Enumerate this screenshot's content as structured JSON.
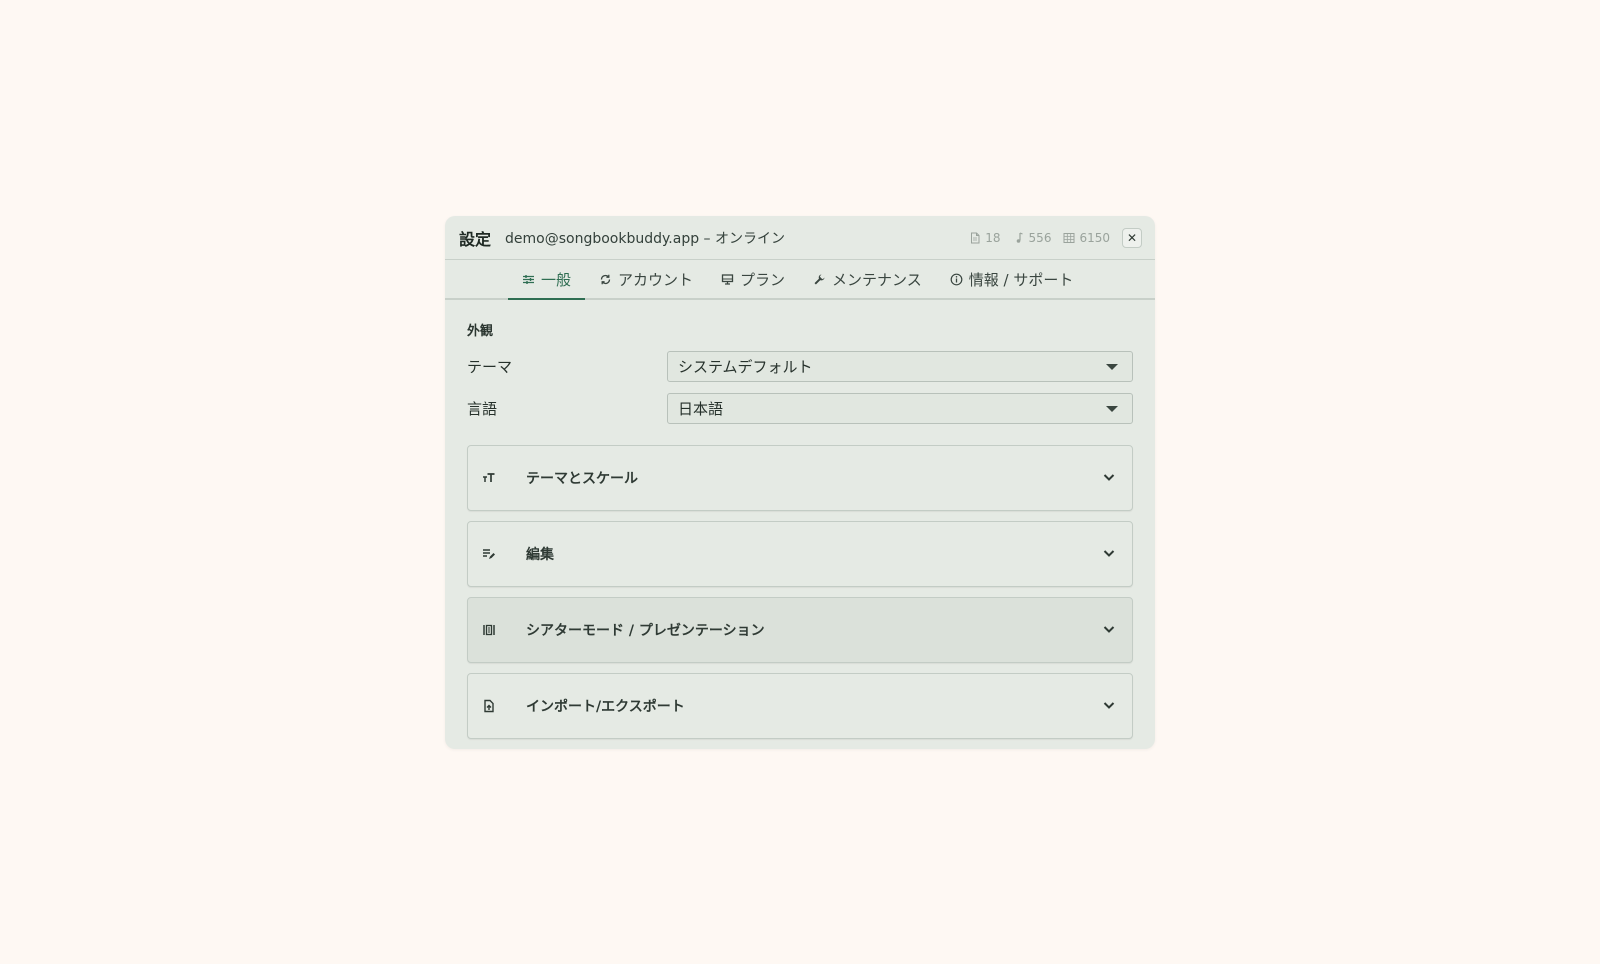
{
  "dialog": {
    "title": "設定",
    "account_status": "demo@songbookbuddy.app – オンライン",
    "stats": [
      {
        "icon": "document-icon",
        "value": "18"
      },
      {
        "icon": "music-note-icon",
        "value": "556"
      },
      {
        "icon": "grid-icon",
        "value": "6150"
      }
    ],
    "close_label": "✕"
  },
  "tabs": [
    {
      "icon": "sliders-icon",
      "label": "一般",
      "active": true
    },
    {
      "icon": "sync-icon",
      "label": "アカウント"
    },
    {
      "icon": "monitor-icon",
      "label": "プラン"
    },
    {
      "icon": "wrench-icon",
      "label": "メンテナンス"
    },
    {
      "icon": "info-icon",
      "label": "情報 / サポート"
    }
  ],
  "appearance": {
    "section_label": "外観",
    "theme_label": "テーマ",
    "theme_value": "システムデフォルト",
    "language_label": "言語",
    "language_value": "日本語"
  },
  "accordion": [
    {
      "icon": "text-size-icon",
      "label": "テーマとスケール"
    },
    {
      "icon": "edit-list-icon",
      "label": "編集"
    },
    {
      "icon": "theater-icon",
      "label": "シアターモード / プレゼンテーション"
    },
    {
      "icon": "file-import-icon",
      "label": "インポート/エクスポート"
    }
  ],
  "colors": {
    "accent": "#2f6e52",
    "background": "#fef8f3",
    "panel": "#e5eae4"
  }
}
